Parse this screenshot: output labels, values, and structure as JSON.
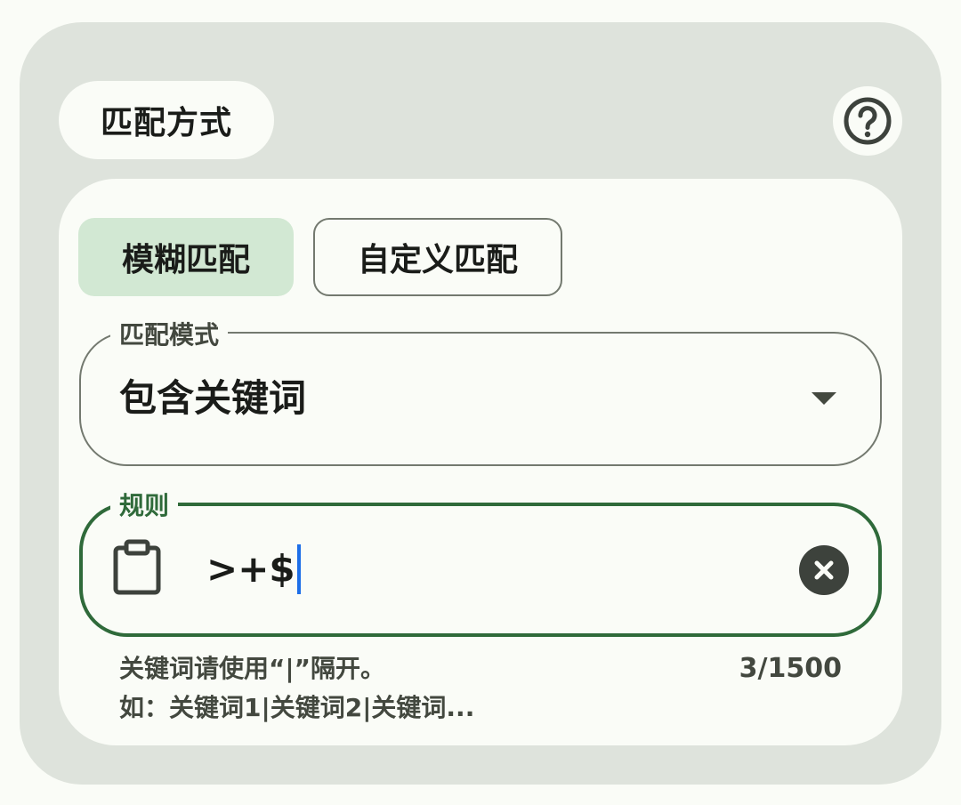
{
  "header": {
    "title": "匹配方式",
    "help_icon": "help-circle-icon"
  },
  "tabs": [
    {
      "label": "模糊匹配",
      "selected": true
    },
    {
      "label": "自定义匹配",
      "selected": false
    }
  ],
  "mode_field": {
    "label": "匹配模式",
    "value": "包含关键词",
    "icon": "dropdown-arrow-icon"
  },
  "rule_field": {
    "label": "规则",
    "value": ">+$",
    "leading_icon": "clipboard-icon",
    "trailing_icon": "clear-icon",
    "hint_line1": "关键词请使用“|”隔开。",
    "hint_line2": "如：关键词1|关键词2|关键词...",
    "counter": "3/1500"
  },
  "colors": {
    "outer_bg": "#dee3dc",
    "surface": "#fafcf7",
    "selected_tab": "#d2e8d3",
    "accent_green": "#2f6a3a",
    "caret": "#1c6ee8"
  }
}
